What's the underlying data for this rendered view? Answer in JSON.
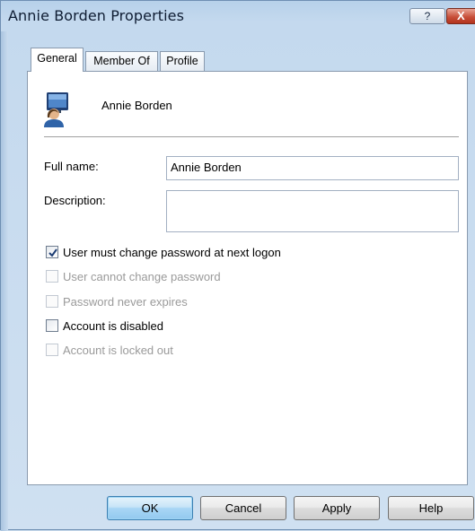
{
  "window": {
    "title": "Annie Borden Properties",
    "help_label": "?",
    "close_label": "X"
  },
  "tabs": [
    {
      "label": "General",
      "active": true
    },
    {
      "label": "Member Of",
      "active": false
    },
    {
      "label": "Profile",
      "active": false
    }
  ],
  "general": {
    "user_icon": "user-computer-icon",
    "display_name": "Annie Borden",
    "full_name_label": "Full name:",
    "full_name_value": "Annie Borden",
    "description_label": "Description:",
    "description_value": "",
    "checkboxes": [
      {
        "label": "User must change password at next logon",
        "checked": true,
        "enabled": true
      },
      {
        "label": "User cannot change password",
        "checked": false,
        "enabled": false
      },
      {
        "label": "Password never expires",
        "checked": false,
        "enabled": false
      },
      {
        "label": "Account is disabled",
        "checked": false,
        "enabled": true
      },
      {
        "label": "Account is locked out",
        "checked": false,
        "enabled": false
      }
    ]
  },
  "buttons": {
    "ok": "OK",
    "cancel": "Cancel",
    "apply": "Apply",
    "help": "Help"
  },
  "colors": {
    "title_bar": "#c4d9ee",
    "close_button": "#c8503a",
    "default_button": "#a9d6f5"
  }
}
